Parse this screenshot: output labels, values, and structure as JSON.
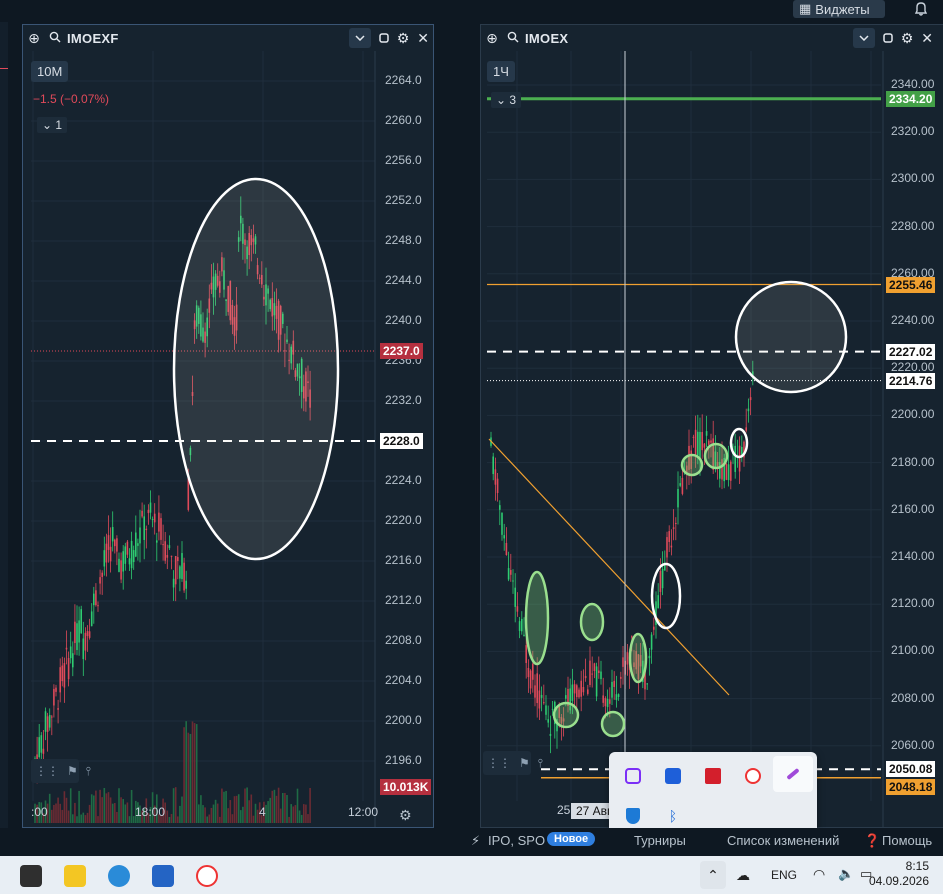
{
  "topbar": {
    "widgets_label": "Виджеты"
  },
  "left_panel": {
    "ticker": "IMOEXF",
    "timeframe": "10M",
    "change": "−1.5 (−0.07%)",
    "count": "1",
    "price_labels": [
      "2264.0",
      "2260.0",
      "2256.0",
      "2252.0",
      "2248.0",
      "2244.0",
      "2240.0",
      "2236.0",
      "2232.0",
      "2228.0",
      "2224.0",
      "2220.0",
      "2216.0",
      "2212.0",
      "2208.0",
      "2204.0",
      "2200.0",
      "2196.0"
    ],
    "current_price_tag": "2237.0",
    "level_tag": "2228.0",
    "volume_tag": "10.013K",
    "time_labels": [
      ":00",
      "18:00",
      "4",
      "12:00"
    ]
  },
  "right_panel": {
    "ticker": "IMOEX",
    "timeframe": "1Ч",
    "count": "3",
    "price_labels": [
      "2340.00",
      "2320.00",
      "2300.00",
      "2280.00",
      "2260.00",
      "2240.00",
      "2220.00",
      "2200.00",
      "2180.00",
      "2160.00",
      "2140.00",
      "2120.00",
      "2100.00",
      "2080.00",
      "2060.00"
    ],
    "tags": {
      "green_level": "2334.20",
      "orange_level": "2255.46",
      "dashed_level": "2227.02",
      "current_price": "2214.76",
      "dashed_low": "2050.08",
      "orange_low": "2048.18"
    },
    "time_labels": [
      "25",
      "27 Авг"
    ]
  },
  "status_bar": {
    "ipo_label": "IPO, SPO",
    "new_badge": "Новое",
    "tournaments": "Турниры",
    "changelog": "Список изменений",
    "help": "Помощь"
  },
  "taskbar": {
    "lang": "ENG",
    "time": "8:15",
    "date": "04.09.2026"
  },
  "colors": {
    "bg": "#16232f",
    "up": "#2ecc71",
    "down": "#e04a5a",
    "green_line": "#4caf50",
    "orange_line": "#f0a030"
  }
}
